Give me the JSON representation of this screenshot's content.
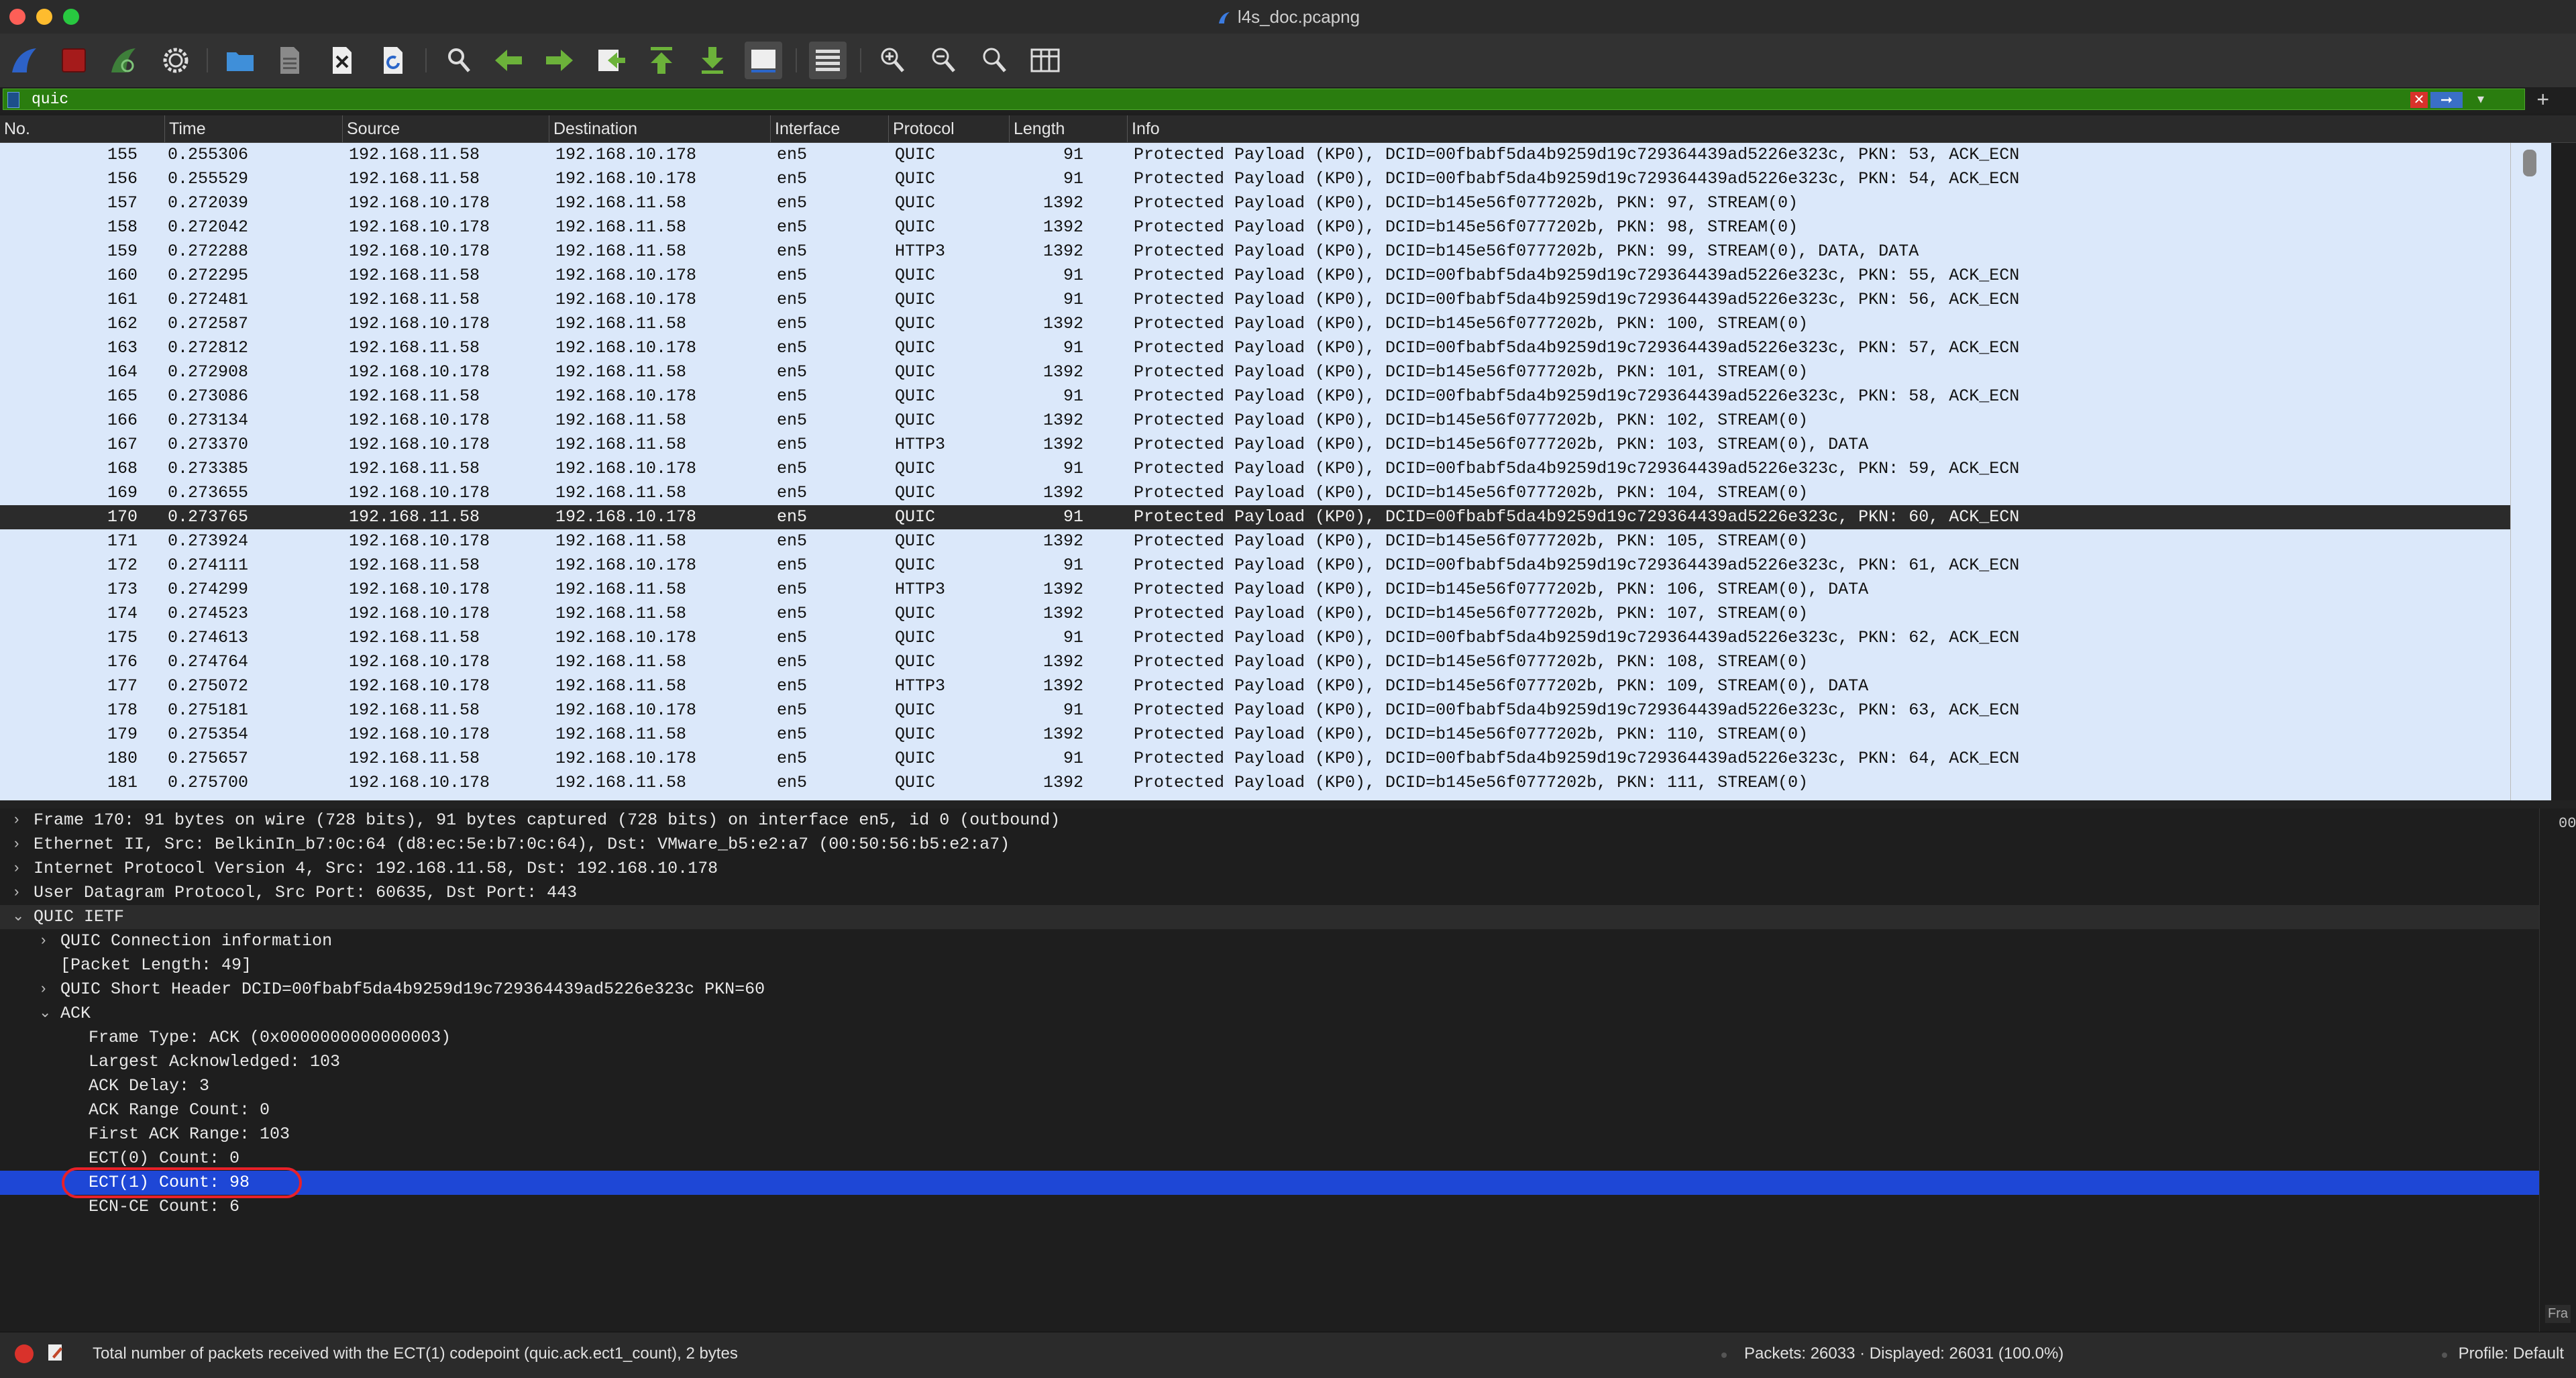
{
  "window": {
    "title": "l4s_doc.pcapng"
  },
  "toolbar": {
    "icons": [
      "shark-fin-start-icon",
      "stop-square-icon",
      "shark-fin-restart-icon",
      "gear-options-icon",
      "open-folder-icon",
      "file-save-icon",
      "close-file-icon",
      "reload-file-icon",
      "find-packet-icon",
      "go-back-arrow-icon",
      "go-forward-arrow-icon",
      "go-to-packet-icon",
      "go-first-icon",
      "go-last-icon",
      "autoscroll-icon",
      "colorize-icon",
      "zoom-in-icon",
      "zoom-out-icon",
      "normal-size-icon",
      "resize-columns-icon"
    ]
  },
  "filter": {
    "value": "quic",
    "plus": "+"
  },
  "columns": [
    "No.",
    "Time",
    "Source",
    "Destination",
    "Interface",
    "Protocol",
    "Length",
    "Info"
  ],
  "packets": [
    {
      "no": "155",
      "time": "0.255306",
      "src": "192.168.11.58",
      "dst": "192.168.10.178",
      "iface": "en5",
      "proto": "QUIC",
      "len": "91",
      "info": "Protected Payload (KP0), DCID=00fbabf5da4b9259d19c729364439ad5226e323c, PKN: 53, ACK_ECN"
    },
    {
      "no": "156",
      "time": "0.255529",
      "src": "192.168.11.58",
      "dst": "192.168.10.178",
      "iface": "en5",
      "proto": "QUIC",
      "len": "91",
      "info": "Protected Payload (KP0), DCID=00fbabf5da4b9259d19c729364439ad5226e323c, PKN: 54, ACK_ECN"
    },
    {
      "no": "157",
      "time": "0.272039",
      "src": "192.168.10.178",
      "dst": "192.168.11.58",
      "iface": "en5",
      "proto": "QUIC",
      "len": "1392",
      "info": "Protected Payload (KP0), DCID=b145e56f0777202b, PKN: 97, STREAM(0)"
    },
    {
      "no": "158",
      "time": "0.272042",
      "src": "192.168.10.178",
      "dst": "192.168.11.58",
      "iface": "en5",
      "proto": "QUIC",
      "len": "1392",
      "info": "Protected Payload (KP0), DCID=b145e56f0777202b, PKN: 98, STREAM(0)"
    },
    {
      "no": "159",
      "time": "0.272288",
      "src": "192.168.10.178",
      "dst": "192.168.11.58",
      "iface": "en5",
      "proto": "HTTP3",
      "len": "1392",
      "info": "Protected Payload (KP0), DCID=b145e56f0777202b, PKN: 99, STREAM(0), DATA, DATA"
    },
    {
      "no": "160",
      "time": "0.272295",
      "src": "192.168.11.58",
      "dst": "192.168.10.178",
      "iface": "en5",
      "proto": "QUIC",
      "len": "91",
      "info": "Protected Payload (KP0), DCID=00fbabf5da4b9259d19c729364439ad5226e323c, PKN: 55, ACK_ECN"
    },
    {
      "no": "161",
      "time": "0.272481",
      "src": "192.168.11.58",
      "dst": "192.168.10.178",
      "iface": "en5",
      "proto": "QUIC",
      "len": "91",
      "info": "Protected Payload (KP0), DCID=00fbabf5da4b9259d19c729364439ad5226e323c, PKN: 56, ACK_ECN"
    },
    {
      "no": "162",
      "time": "0.272587",
      "src": "192.168.10.178",
      "dst": "192.168.11.58",
      "iface": "en5",
      "proto": "QUIC",
      "len": "1392",
      "info": "Protected Payload (KP0), DCID=b145e56f0777202b, PKN: 100, STREAM(0)"
    },
    {
      "no": "163",
      "time": "0.272812",
      "src": "192.168.11.58",
      "dst": "192.168.10.178",
      "iface": "en5",
      "proto": "QUIC",
      "len": "91",
      "info": "Protected Payload (KP0), DCID=00fbabf5da4b9259d19c729364439ad5226e323c, PKN: 57, ACK_ECN"
    },
    {
      "no": "164",
      "time": "0.272908",
      "src": "192.168.10.178",
      "dst": "192.168.11.58",
      "iface": "en5",
      "proto": "QUIC",
      "len": "1392",
      "info": "Protected Payload (KP0), DCID=b145e56f0777202b, PKN: 101, STREAM(0)"
    },
    {
      "no": "165",
      "time": "0.273086",
      "src": "192.168.11.58",
      "dst": "192.168.10.178",
      "iface": "en5",
      "proto": "QUIC",
      "len": "91",
      "info": "Protected Payload (KP0), DCID=00fbabf5da4b9259d19c729364439ad5226e323c, PKN: 58, ACK_ECN"
    },
    {
      "no": "166",
      "time": "0.273134",
      "src": "192.168.10.178",
      "dst": "192.168.11.58",
      "iface": "en5",
      "proto": "QUIC",
      "len": "1392",
      "info": "Protected Payload (KP0), DCID=b145e56f0777202b, PKN: 102, STREAM(0)"
    },
    {
      "no": "167",
      "time": "0.273370",
      "src": "192.168.10.178",
      "dst": "192.168.11.58",
      "iface": "en5",
      "proto": "HTTP3",
      "len": "1392",
      "info": "Protected Payload (KP0), DCID=b145e56f0777202b, PKN: 103, STREAM(0), DATA"
    },
    {
      "no": "168",
      "time": "0.273385",
      "src": "192.168.11.58",
      "dst": "192.168.10.178",
      "iface": "en5",
      "proto": "QUIC",
      "len": "91",
      "info": "Protected Payload (KP0), DCID=00fbabf5da4b9259d19c729364439ad5226e323c, PKN: 59, ACK_ECN"
    },
    {
      "no": "169",
      "time": "0.273655",
      "src": "192.168.10.178",
      "dst": "192.168.11.58",
      "iface": "en5",
      "proto": "QUIC",
      "len": "1392",
      "info": "Protected Payload (KP0), DCID=b145e56f0777202b, PKN: 104, STREAM(0)"
    },
    {
      "no": "170",
      "time": "0.273765",
      "src": "192.168.11.58",
      "dst": "192.168.10.178",
      "iface": "en5",
      "proto": "QUIC",
      "len": "91",
      "info": "Protected Payload (KP0), DCID=00fbabf5da4b9259d19c729364439ad5226e323c, PKN: 60, ACK_ECN",
      "selected": true
    },
    {
      "no": "171",
      "time": "0.273924",
      "src": "192.168.10.178",
      "dst": "192.168.11.58",
      "iface": "en5",
      "proto": "QUIC",
      "len": "1392",
      "info": "Protected Payload (KP0), DCID=b145e56f0777202b, PKN: 105, STREAM(0)"
    },
    {
      "no": "172",
      "time": "0.274111",
      "src": "192.168.11.58",
      "dst": "192.168.10.178",
      "iface": "en5",
      "proto": "QUIC",
      "len": "91",
      "info": "Protected Payload (KP0), DCID=00fbabf5da4b9259d19c729364439ad5226e323c, PKN: 61, ACK_ECN"
    },
    {
      "no": "173",
      "time": "0.274299",
      "src": "192.168.10.178",
      "dst": "192.168.11.58",
      "iface": "en5",
      "proto": "HTTP3",
      "len": "1392",
      "info": "Protected Payload (KP0), DCID=b145e56f0777202b, PKN: 106, STREAM(0), DATA"
    },
    {
      "no": "174",
      "time": "0.274523",
      "src": "192.168.10.178",
      "dst": "192.168.11.58",
      "iface": "en5",
      "proto": "QUIC",
      "len": "1392",
      "info": "Protected Payload (KP0), DCID=b145e56f0777202b, PKN: 107, STREAM(0)"
    },
    {
      "no": "175",
      "time": "0.274613",
      "src": "192.168.11.58",
      "dst": "192.168.10.178",
      "iface": "en5",
      "proto": "QUIC",
      "len": "91",
      "info": "Protected Payload (KP0), DCID=00fbabf5da4b9259d19c729364439ad5226e323c, PKN: 62, ACK_ECN"
    },
    {
      "no": "176",
      "time": "0.274764",
      "src": "192.168.10.178",
      "dst": "192.168.11.58",
      "iface": "en5",
      "proto": "QUIC",
      "len": "1392",
      "info": "Protected Payload (KP0), DCID=b145e56f0777202b, PKN: 108, STREAM(0)"
    },
    {
      "no": "177",
      "time": "0.275072",
      "src": "192.168.10.178",
      "dst": "192.168.11.58",
      "iface": "en5",
      "proto": "HTTP3",
      "len": "1392",
      "info": "Protected Payload (KP0), DCID=b145e56f0777202b, PKN: 109, STREAM(0), DATA"
    },
    {
      "no": "178",
      "time": "0.275181",
      "src": "192.168.11.58",
      "dst": "192.168.10.178",
      "iface": "en5",
      "proto": "QUIC",
      "len": "91",
      "info": "Protected Payload (KP0), DCID=00fbabf5da4b9259d19c729364439ad5226e323c, PKN: 63, ACK_ECN"
    },
    {
      "no": "179",
      "time": "0.275354",
      "src": "192.168.10.178",
      "dst": "192.168.11.58",
      "iface": "en5",
      "proto": "QUIC",
      "len": "1392",
      "info": "Protected Payload (KP0), DCID=b145e56f0777202b, PKN: 110, STREAM(0)"
    },
    {
      "no": "180",
      "time": "0.275657",
      "src": "192.168.11.58",
      "dst": "192.168.10.178",
      "iface": "en5",
      "proto": "QUIC",
      "len": "91",
      "info": "Protected Payload (KP0), DCID=00fbabf5da4b9259d19c729364439ad5226e323c, PKN: 64, ACK_ECN"
    },
    {
      "no": "181",
      "time": "0.275700",
      "src": "192.168.10.178",
      "dst": "192.168.11.58",
      "iface": "en5",
      "proto": "QUIC",
      "len": "1392",
      "info": "Protected Payload (KP0), DCID=b145e56f0777202b, PKN: 111, STREAM(0)"
    }
  ],
  "details": [
    {
      "text": "Frame 170: 91 bytes on wire (728 bits), 91 bytes captured (728 bits) on interface en5, id 0 (outbound)",
      "level": 0,
      "expander": "›"
    },
    {
      "text": "Ethernet II, Src: BelkinIn_b7:0c:64 (d8:ec:5e:b7:0c:64), Dst: VMware_b5:e2:a7 (00:50:56:b5:e2:a7)",
      "level": 0,
      "expander": "›"
    },
    {
      "text": "Internet Protocol Version 4, Src: 192.168.11.58, Dst: 192.168.10.178",
      "level": 0,
      "expander": "›"
    },
    {
      "text": "User Datagram Protocol, Src Port: 60635, Dst Port: 443",
      "level": 0,
      "expander": "›"
    },
    {
      "text": "QUIC IETF",
      "level": 0,
      "expander": "⌄",
      "bar": true
    },
    {
      "text": "QUIC Connection information",
      "level": 1,
      "expander": "›"
    },
    {
      "text": "[Packet Length: 49]",
      "level": 1,
      "expander": ""
    },
    {
      "text": "QUIC Short Header DCID=00fbabf5da4b9259d19c729364439ad5226e323c PKN=60",
      "level": 1,
      "expander": "›"
    },
    {
      "text": "ACK",
      "level": 1,
      "expander": "⌄"
    },
    {
      "text": "Frame Type: ACK (0x0000000000000003)",
      "level": 2,
      "expander": ""
    },
    {
      "text": "Largest Acknowledged: 103",
      "level": 2,
      "expander": ""
    },
    {
      "text": "ACK Delay: 3",
      "level": 2,
      "expander": ""
    },
    {
      "text": "ACK Range Count: 0",
      "level": 2,
      "expander": ""
    },
    {
      "text": "First ACK Range: 103",
      "level": 2,
      "expander": ""
    },
    {
      "text": "ECT(0) Count: 0",
      "level": 2,
      "expander": ""
    },
    {
      "text": "ECT(1) Count: 98",
      "level": 2,
      "expander": "",
      "highlighted": true
    },
    {
      "text": "ECN-CE Count: 6",
      "level": 2,
      "expander": ""
    }
  ],
  "bytes_pane": {
    "offset_hint": "00",
    "button": "Fra"
  },
  "status": {
    "message": "Total number of packets received with the ECT(1) codepoint (quic.ack.ect1_count), 2 bytes",
    "packets": "Packets: 26033 · Displayed: 26031 (100.0%)",
    "profile": "Profile: Default"
  },
  "colors": {
    "row_bg": "#dbe8fa",
    "selected_row": "#2b2b2b",
    "detail_highlight": "#1e47d6",
    "filter_valid": "#2a7d0f",
    "annotation": "#e8212a"
  }
}
